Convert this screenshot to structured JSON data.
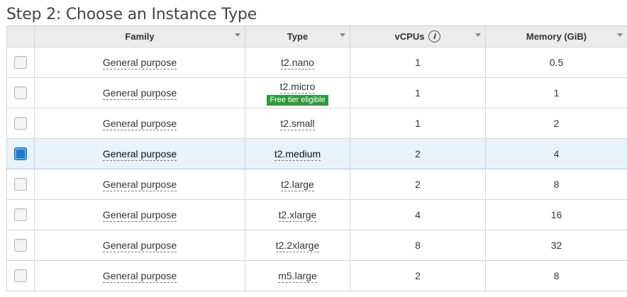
{
  "page": {
    "title": "Step 2: Choose an Instance Type"
  },
  "table": {
    "columns": [
      {
        "label": "Family"
      },
      {
        "label": "Type"
      },
      {
        "label": "vCPUs",
        "info_icon": "info-icon"
      },
      {
        "label": "Memory (GiB)"
      }
    ],
    "rows": [
      {
        "selected": false,
        "family": "General purpose",
        "type": "t2.nano",
        "vcpus": "1",
        "memory": "0.5",
        "badge": ""
      },
      {
        "selected": false,
        "family": "General purpose",
        "type": "t2.micro",
        "vcpus": "1",
        "memory": "1",
        "badge": "Free tier eligible"
      },
      {
        "selected": false,
        "family": "General purpose",
        "type": "t2.small",
        "vcpus": "1",
        "memory": "2",
        "badge": ""
      },
      {
        "selected": true,
        "family": "General purpose",
        "type": "t2.medium",
        "vcpus": "2",
        "memory": "4",
        "badge": ""
      },
      {
        "selected": false,
        "family": "General purpose",
        "type": "t2.large",
        "vcpus": "2",
        "memory": "8",
        "badge": ""
      },
      {
        "selected": false,
        "family": "General purpose",
        "type": "t2.xlarge",
        "vcpus": "4",
        "memory": "16",
        "badge": ""
      },
      {
        "selected": false,
        "family": "General purpose",
        "type": "t2.2xlarge",
        "vcpus": "8",
        "memory": "32",
        "badge": ""
      },
      {
        "selected": false,
        "family": "General purpose",
        "type": "m5.large",
        "vcpus": "2",
        "memory": "8",
        "badge": ""
      }
    ]
  },
  "colors": {
    "selected_row": "#e7f2fb",
    "checkbox_on": "#1e78c8",
    "badge_bg": "#2f9a3c"
  }
}
